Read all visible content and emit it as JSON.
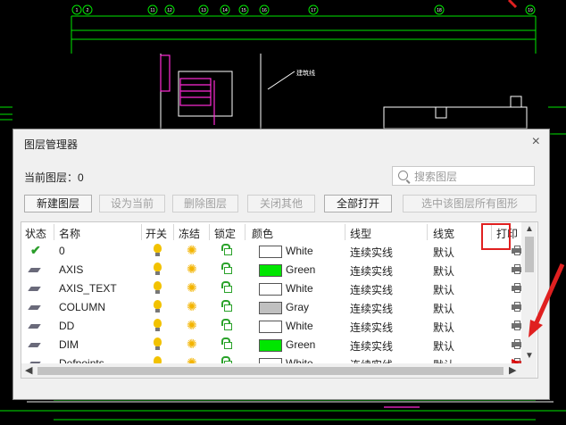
{
  "dialog": {
    "title": "图层管理器",
    "close_glyph": "×",
    "current_layer_label": "当前图层：",
    "current_layer_value": "0",
    "search_placeholder": "搜索图层"
  },
  "toolbar": {
    "new_layer": "新建图层",
    "set_current": "设为当前",
    "delete_layer": "删除图层",
    "close_others": "关闭其他",
    "open_all": "全部打开",
    "select_all_in_layer": "选中该图层所有图形"
  },
  "columns": {
    "status": "状态",
    "name": "名称",
    "on": "开关",
    "freeze": "冻结",
    "lock": "锁定",
    "color": "颜色",
    "linetype": "线型",
    "lineweight": "线宽",
    "plot": "打印"
  },
  "layers": [
    {
      "name": "0",
      "color_name": "White",
      "color_hex": "#ffffff",
      "linetype": "连续实线",
      "lineweight": "默认",
      "current": true,
      "plot": true
    },
    {
      "name": "AXIS",
      "color_name": "Green",
      "color_hex": "#00e600",
      "linetype": "连续实线",
      "lineweight": "默认",
      "current": false,
      "plot": true
    },
    {
      "name": "AXIS_TEXT",
      "color_name": "White",
      "color_hex": "#ffffff",
      "linetype": "连续实线",
      "lineweight": "默认",
      "current": false,
      "plot": true
    },
    {
      "name": "COLUMN",
      "color_name": "Gray",
      "color_hex": "#c0c0c0",
      "linetype": "连续实线",
      "lineweight": "默认",
      "current": false,
      "plot": true
    },
    {
      "name": "DD",
      "color_name": "White",
      "color_hex": "#ffffff",
      "linetype": "连续实线",
      "lineweight": "默认",
      "current": false,
      "plot": true
    },
    {
      "name": "DIM",
      "color_name": "Green",
      "color_hex": "#00e600",
      "linetype": "连续实线",
      "lineweight": "默认",
      "current": false,
      "plot": true
    },
    {
      "name": "Defpoints",
      "color_name": "White",
      "color_hex": "#ffffff",
      "linetype": "连续实线",
      "lineweight": "默认",
      "current": false,
      "plot": false
    }
  ],
  "icons": {
    "on": "lightbulb-icon",
    "freeze": "sun-icon",
    "lock": "unlock-icon",
    "plot": "printer-icon",
    "plot_disabled": "printer-disabled-icon",
    "search": "search-icon"
  },
  "colors": {
    "highlight": "#e02020",
    "cad_background": "#000000",
    "cad_lines": "#00e600",
    "cad_accent": "#ff2bd6"
  },
  "cad_text": {
    "axis_labels": [
      "1",
      "2",
      "11",
      "12",
      "13",
      "14",
      "15",
      "16",
      "17",
      "18",
      "19"
    ],
    "note": "建筑线"
  }
}
